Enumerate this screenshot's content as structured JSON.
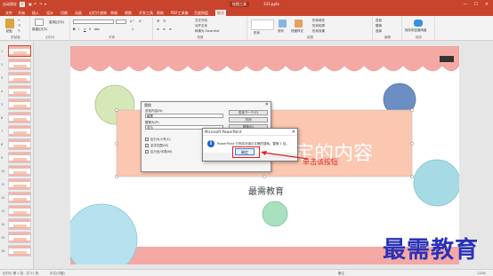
{
  "titlebar": {
    "autosave": "自动保存",
    "autosave_state": "关",
    "filename": "333.pptx",
    "tool_context": "绘图工具",
    "minimize": "—",
    "maximize": "☐",
    "close": "✕"
  },
  "tabs": [
    {
      "label": "文件",
      "name": "tab-file"
    },
    {
      "label": "开始",
      "name": "tab-home"
    },
    {
      "label": "插入",
      "name": "tab-insert"
    },
    {
      "label": "设计",
      "name": "tab-design"
    },
    {
      "label": "切换",
      "name": "tab-transitions"
    },
    {
      "label": "动画",
      "name": "tab-animations"
    },
    {
      "label": "幻灯片放映",
      "name": "tab-slideshow"
    },
    {
      "label": "审阅",
      "name": "tab-review"
    },
    {
      "label": "视图",
      "name": "tab-view"
    },
    {
      "label": "开发工具",
      "name": "tab-developer"
    },
    {
      "label": "帮助",
      "name": "tab-help"
    },
    {
      "label": "PDF工具集",
      "name": "tab-pdf"
    },
    {
      "label": "百度网盘",
      "name": "tab-baidu"
    },
    {
      "label": "格式",
      "name": "tab-format"
    }
  ],
  "ribbon": {
    "groups": [
      "剪贴板",
      "幻灯片",
      "字体",
      "段落",
      "绘图",
      "编辑",
      "保存"
    ],
    "paste": "粘贴",
    "new_slide": "新建幻灯片",
    "reuse": "重用幻灯片",
    "text_direction": "文字方向",
    "align_text": "对齐文本",
    "convert_smartart": "转换为 SmartArt",
    "shapes": "形状",
    "arrange": "排列",
    "quick_styles": "快速样式",
    "shape_fill": "形状填充",
    "shape_outline": "形状轮廓",
    "shape_effects": "形状效果",
    "find": "查找",
    "replace": "替换",
    "select": "选择",
    "save_to_baidu": "保存到百度网盘"
  },
  "slide": {
    "main_text": "改为选定的指定的内容",
    "subtitle": "最需教育"
  },
  "replace_dialog": {
    "title": "替换",
    "close": "✕",
    "find_label": "查找内容(N):",
    "find_value": "最需",
    "replace_label": "替换为(P):",
    "replace_value": "改为",
    "find_next": "查找下一个(F)",
    "close_btn": "关闭",
    "replace_btn": "替换(R)",
    "replace_all": "全部替换(A)",
    "match_case": "区分大小写(C)",
    "whole_word": "全字匹配(W)",
    "half_full": "区分全/半角(M)"
  },
  "msgbox": {
    "title": "Microsoft PowerPoint",
    "close": "✕",
    "message": "PowerPoint 已完成对演示文稿的搜索。替换 1 处。",
    "ok": "确定"
  },
  "annotation": "单击该按钮",
  "watermark": "最需教育",
  "statusbar": {
    "slide_info": "幻灯片 第 1 张，共 21 张",
    "language": "中文(中国)",
    "notes": "备注",
    "zoom": "110%"
  },
  "thumbnails": [
    "1",
    "2",
    "3",
    "4",
    "5",
    "6",
    "7",
    "8",
    "9",
    "10",
    "11",
    "12",
    "13",
    "14",
    "15",
    "16",
    "17"
  ],
  "colors": {
    "accent": "#c8442c",
    "scallop": "#f4a9a5",
    "banner": "#fbc7b0",
    "annotation": "#e02020",
    "watermark": "#2a32b8"
  }
}
